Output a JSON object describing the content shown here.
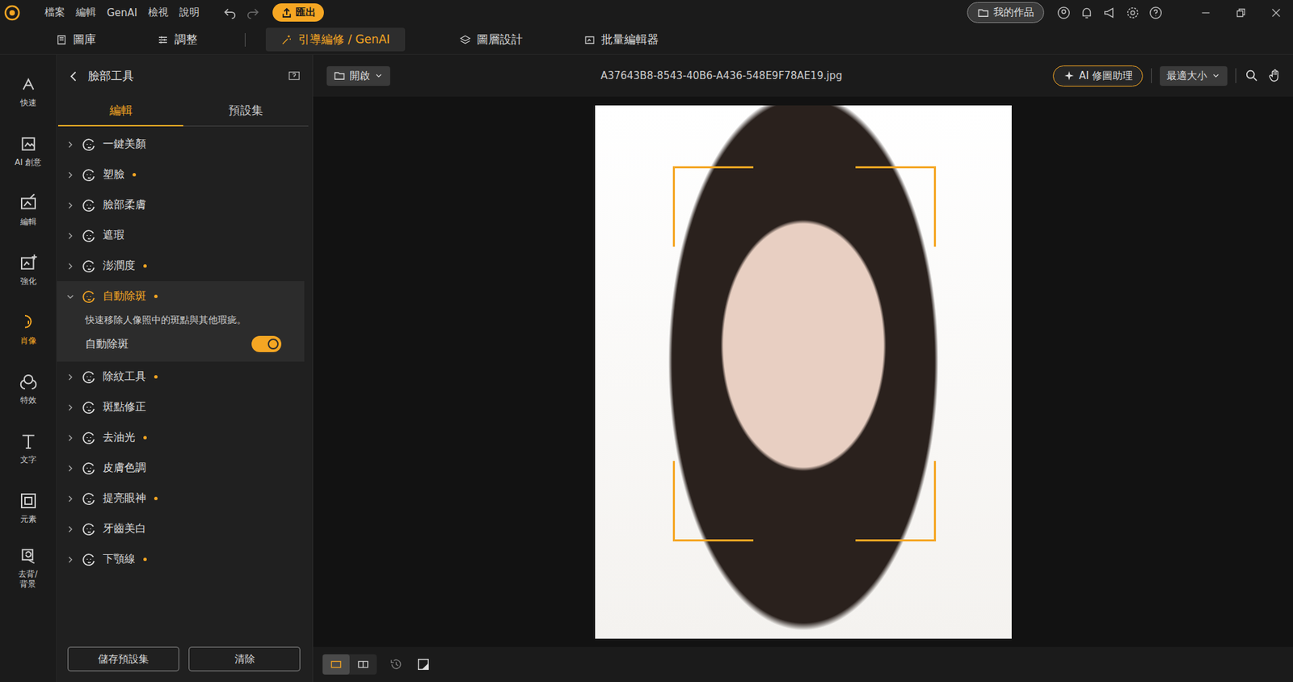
{
  "menu": [
    "檔案",
    "編輯",
    "GenAI",
    "檢視",
    "說明"
  ],
  "export_button": "匯出",
  "my_works_button": "我的作品",
  "mode_tabs": [
    {
      "label": "圖庫",
      "selected": false
    },
    {
      "label": "調整",
      "selected": false
    },
    {
      "label": "引導編修 / GenAI",
      "selected": true
    },
    {
      "label": "圖層設計",
      "selected": false
    },
    {
      "label": "批量編輯器",
      "selected": false
    }
  ],
  "sidebar": [
    {
      "label": "快速",
      "selected": false
    },
    {
      "label": "AI 創意",
      "selected": false
    },
    {
      "label": "編輯",
      "selected": false
    },
    {
      "label": "強化",
      "selected": false
    },
    {
      "label": "肖像",
      "selected": true
    },
    {
      "label": "特效",
      "selected": false
    },
    {
      "label": "文字",
      "selected": false
    },
    {
      "label": "元素",
      "selected": false
    },
    {
      "label": "去背/\n背景",
      "selected": false
    }
  ],
  "panel": {
    "title": "臉部工具",
    "tabs": [
      {
        "label": "編輯",
        "selected": true
      },
      {
        "label": "預設集",
        "selected": false
      }
    ],
    "tools": [
      {
        "label": "一鍵美顏",
        "modified": false,
        "expanded": false
      },
      {
        "label": "塑臉",
        "modified": true,
        "expanded": false
      },
      {
        "label": "臉部柔膚",
        "modified": false,
        "expanded": false
      },
      {
        "label": "遮瑕",
        "modified": false,
        "expanded": false
      },
      {
        "label": "澎潤度",
        "modified": true,
        "expanded": false
      },
      {
        "label": "自動除斑",
        "modified": true,
        "expanded": true,
        "description": "快速移除人像照中的斑點與其他瑕疵。",
        "toggle": {
          "label": "自動除斑",
          "on": true
        }
      },
      {
        "label": "除紋工具",
        "modified": true,
        "expanded": false
      },
      {
        "label": "斑點修正",
        "modified": false,
        "expanded": false
      },
      {
        "label": "去油光",
        "modified": true,
        "expanded": false
      },
      {
        "label": "皮膚色調",
        "modified": false,
        "expanded": false
      },
      {
        "label": "提亮眼神",
        "modified": true,
        "expanded": false
      },
      {
        "label": "牙齒美白",
        "modified": false,
        "expanded": false
      },
      {
        "label": "下顎線",
        "modified": true,
        "expanded": false
      }
    ],
    "buttons": [
      "儲存預設集",
      "清除"
    ]
  },
  "canvas": {
    "open_button": "開啟",
    "filename": "A37643B8-8543-40B6-A436-548E9F78AE19.jpg",
    "ai_button": "AI 修圖助理",
    "zoom": "最適大小",
    "view_modes": [
      {
        "kind": "single",
        "selected": true
      },
      {
        "kind": "compare",
        "selected": false
      }
    ]
  }
}
